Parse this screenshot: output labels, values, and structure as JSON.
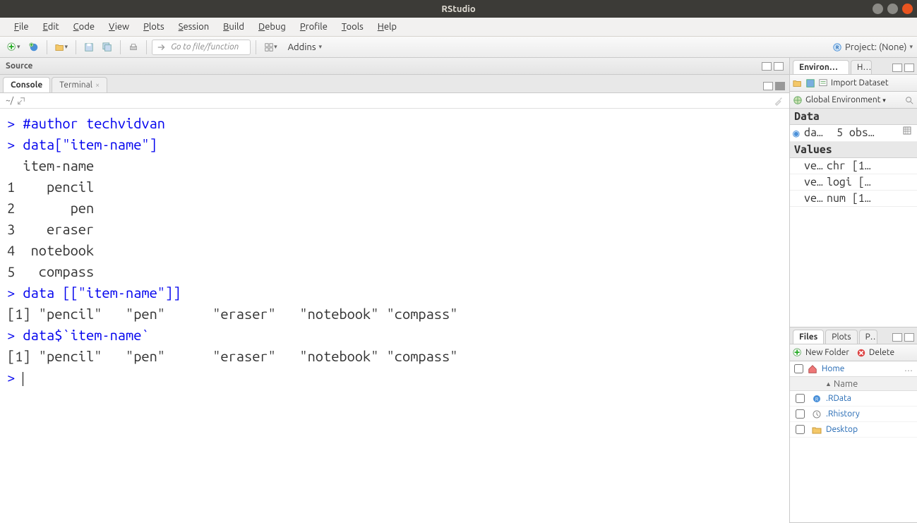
{
  "window": {
    "title": "RStudio"
  },
  "menu": [
    "File",
    "Edit",
    "Code",
    "View",
    "Plots",
    "Session",
    "Build",
    "Debug",
    "Profile",
    "Tools",
    "Help"
  ],
  "toolbar": {
    "goto_placeholder": "Go to file/function",
    "addins_label": "Addins",
    "project_label": "Project: (None)"
  },
  "source": {
    "label": "Source"
  },
  "console_tabs": {
    "console": "Console",
    "terminal": "Terminal"
  },
  "console_path": "~/",
  "console_lines": [
    {
      "t": "in",
      "text": "#author techvidvan"
    },
    {
      "t": "in",
      "text": "data[\"item-name\"]"
    },
    {
      "t": "out",
      "text": "  item-name"
    },
    {
      "t": "out",
      "text": "1    pencil"
    },
    {
      "t": "out",
      "text": "2       pen"
    },
    {
      "t": "out",
      "text": "3    eraser"
    },
    {
      "t": "out",
      "text": "4  notebook"
    },
    {
      "t": "out",
      "text": "5   compass"
    },
    {
      "t": "in",
      "text": "data [[\"item-name\"]]"
    },
    {
      "t": "out",
      "text": "[1] \"pencil\"   \"pen\"      \"eraser\"   \"notebook\" \"compass\" "
    },
    {
      "t": "in",
      "text": "data$`item-name`"
    },
    {
      "t": "out",
      "text": "[1] \"pencil\"   \"pen\"      \"eraser\"   \"notebook\" \"compass\" "
    }
  ],
  "env": {
    "tab_env": "Environment",
    "tab_hist": "History",
    "import_label": "Import Dataset",
    "scope_label": "Global Environment",
    "sections": {
      "data": "Data",
      "values": "Values"
    },
    "data_rows": [
      {
        "name": "da…",
        "value": "5 obs…",
        "has_table": true
      }
    ],
    "value_rows": [
      {
        "name": "ve…",
        "value": "chr [1…"
      },
      {
        "name": "ve…",
        "value": "logi […"
      },
      {
        "name": "ve…",
        "value": "num [1…"
      }
    ]
  },
  "files": {
    "tab_files": "Files",
    "tab_plots": "Plots",
    "tab_packages": "Packages",
    "newfolder": "New Folder",
    "delete": "Delete",
    "home": "Home",
    "col_name": "Name",
    "rows": [
      {
        "icon": "rdata",
        "name": ".RData"
      },
      {
        "icon": "rhist",
        "name": ".Rhistory"
      },
      {
        "icon": "folder",
        "name": "Desktop"
      }
    ]
  }
}
